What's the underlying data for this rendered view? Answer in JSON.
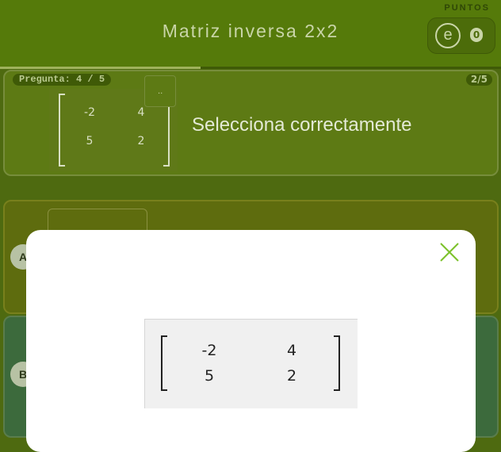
{
  "header": {
    "title": "Matriz inversa 2x2",
    "points_label": "PUNTOS",
    "score_icon": "e",
    "score_value": "0",
    "progress": 0.4
  },
  "question": {
    "badge": "Pregunta: 4 / 5",
    "page": "2/5",
    "prompt": "Selecciona correctamente",
    "zoom_icon": "..",
    "matrix": [
      [
        "-2",
        "4"
      ],
      [
        "5",
        "2"
      ]
    ]
  },
  "options": [
    {
      "letter": "A"
    },
    {
      "letter": "B"
    }
  ],
  "modal": {
    "close_icon": "close-x-icon",
    "matrix": [
      [
        "-2",
        "4"
      ],
      [
        "5",
        "2"
      ]
    ]
  },
  "colors": {
    "header_bg": "#557a0a",
    "accent_green": "#7cc12a"
  }
}
